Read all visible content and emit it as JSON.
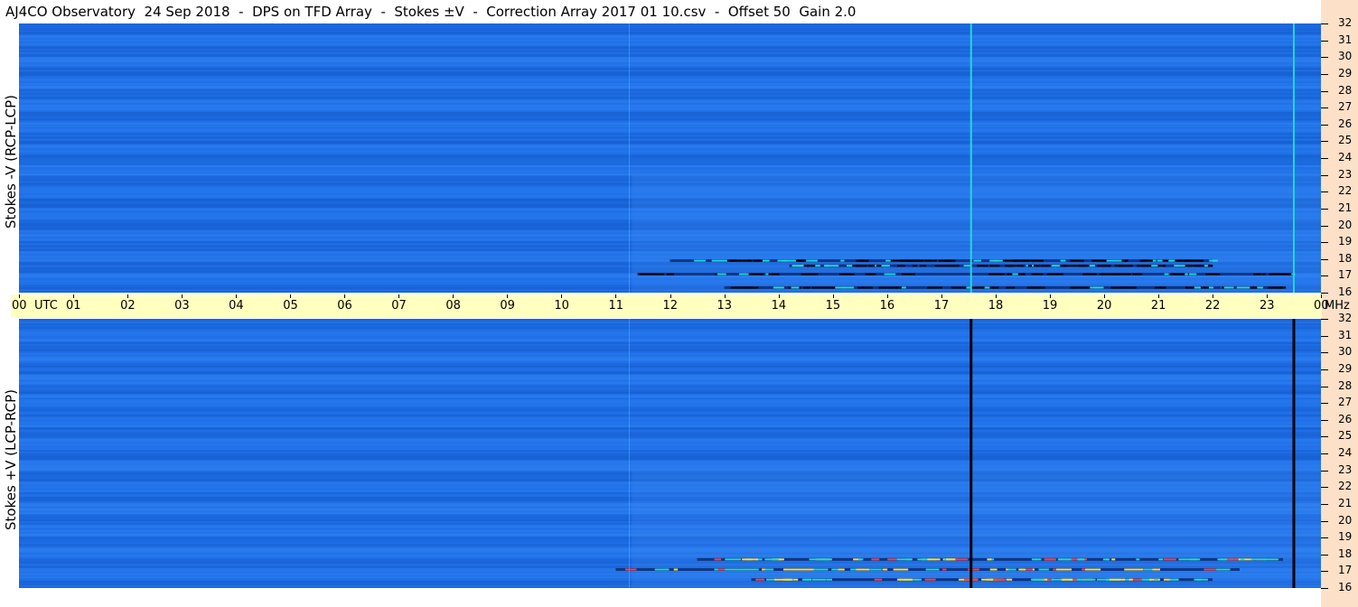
{
  "title": "AJ4CO Observatory  24 Sep 2018  -  DPS on TFD Array  -  Stokes ±V  -  Correction Array 2017 01 10.csv  -  Offset 50  Gain 2.0",
  "colors": {
    "background_blue": "#1f6fe8",
    "dark_band": "#1050b8",
    "light_band": "#3a8cf5",
    "cyan_line": "#22d8d8",
    "black_line": "#000000",
    "time_bar": "#ffffc0",
    "freq_bar": "#fde0c8",
    "signal_yellow": "#ffe040",
    "signal_red": "#ff4040"
  },
  "chart_data": [
    {
      "type": "heatmap",
      "panel": "top",
      "ylabel": "Stokes -V (RCP-LCP)",
      "xlabel": "UTC",
      "x_ticks": [
        "00",
        "01",
        "02",
        "03",
        "04",
        "05",
        "06",
        "07",
        "08",
        "09",
        "10",
        "11",
        "12",
        "13",
        "14",
        "15",
        "16",
        "17",
        "18",
        "19",
        "20",
        "21",
        "22",
        "23",
        "00"
      ],
      "xlim": [
        0,
        24
      ],
      "ylim": [
        16,
        32
      ],
      "y_unit": "MHz",
      "y_ticks": [
        "16",
        "17",
        "18",
        "19",
        "20",
        "21",
        "22",
        "23",
        "24",
        "25",
        "26",
        "27",
        "28",
        "29",
        "30",
        "31",
        "32"
      ],
      "vertical_lines": [
        {
          "utc": 17.55,
          "color": "cyan"
        },
        {
          "utc": 23.5,
          "color": "cyan"
        },
        {
          "utc": 11.25,
          "color": "cyan-faint"
        }
      ],
      "emission_bands": [
        {
          "utc_start": 12.0,
          "utc_end": 22.0,
          "mhz": 17.9
        },
        {
          "utc_start": 11.4,
          "utc_end": 23.5,
          "mhz": 17.1
        },
        {
          "utc_start": 13.0,
          "utc_end": 23.3,
          "mhz": 16.3
        },
        {
          "utc_start": 14.2,
          "utc_end": 22.0,
          "mhz": 17.6
        }
      ]
    },
    {
      "type": "heatmap",
      "panel": "bottom",
      "ylabel": "Stokes +V (LCP-RCP)",
      "xlabel": "UTC",
      "x_ticks": [
        "00",
        "01",
        "02",
        "03",
        "04",
        "05",
        "06",
        "07",
        "08",
        "09",
        "10",
        "11",
        "12",
        "13",
        "14",
        "15",
        "16",
        "17",
        "18",
        "19",
        "20",
        "21",
        "22",
        "23",
        "00"
      ],
      "xlim": [
        0,
        24
      ],
      "ylim": [
        16,
        32
      ],
      "y_unit": "MHz",
      "y_ticks": [
        "16",
        "17",
        "18",
        "19",
        "20",
        "21",
        "22",
        "23",
        "24",
        "25",
        "26",
        "27",
        "28",
        "29",
        "30",
        "31",
        "32"
      ],
      "vertical_lines": [
        {
          "utc": 17.55,
          "color": "black"
        },
        {
          "utc": 23.5,
          "color": "black"
        },
        {
          "utc": 11.25,
          "color": "cyan-faint"
        }
      ],
      "emission_bands": [
        {
          "utc_start": 12.5,
          "utc_end": 23.3,
          "mhz": 17.7
        },
        {
          "utc_start": 11.0,
          "utc_end": 22.5,
          "mhz": 17.1
        },
        {
          "utc_start": 13.5,
          "utc_end": 22.0,
          "mhz": 16.5
        }
      ]
    }
  ]
}
